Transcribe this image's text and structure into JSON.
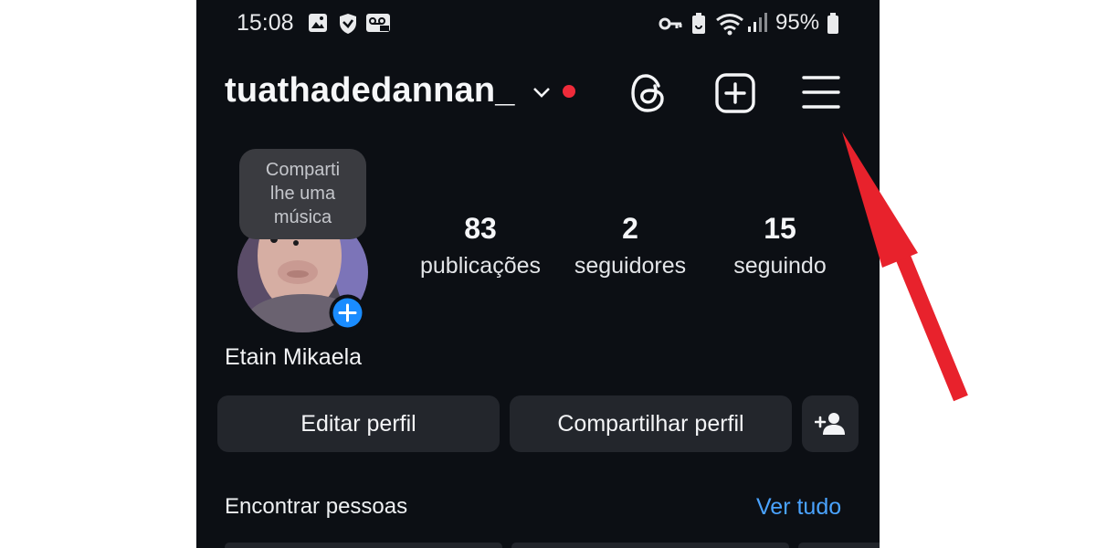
{
  "status_bar": {
    "time": "15:08",
    "battery": "95%"
  },
  "header": {
    "username": "tuathadedannan_"
  },
  "profile": {
    "tooltip": {
      "lines": [
        "Comparti",
        "lhe uma",
        "música"
      ]
    },
    "stats": {
      "posts": {
        "count": "83",
        "label": "publicações"
      },
      "followers": {
        "count": "2",
        "label": "seguidores"
      },
      "following": {
        "count": "15",
        "label": "seguindo"
      }
    },
    "display_name": "Etain Mikaela"
  },
  "actions": {
    "edit_profile": "Editar perfil",
    "share_profile": "Compartilhar perfil"
  },
  "suggestions": {
    "title": "Encontrar pessoas",
    "see_all": "Ver tudo"
  },
  "colors": {
    "background": "#0c0f14",
    "button_bg": "#23262c",
    "link_blue": "#4aa3ff",
    "notification_dot": "#ef2b3a",
    "annotation_arrow": "#e8222c"
  },
  "icons": [
    "gallery-icon",
    "shield-icon",
    "voicemail-icon",
    "key-icon",
    "battery-saver-icon",
    "wifi-icon",
    "signal-icon",
    "battery-icon",
    "chevron-down-icon",
    "threads-icon",
    "create-icon",
    "menu-icon",
    "add-story-icon",
    "add-person-icon"
  ]
}
